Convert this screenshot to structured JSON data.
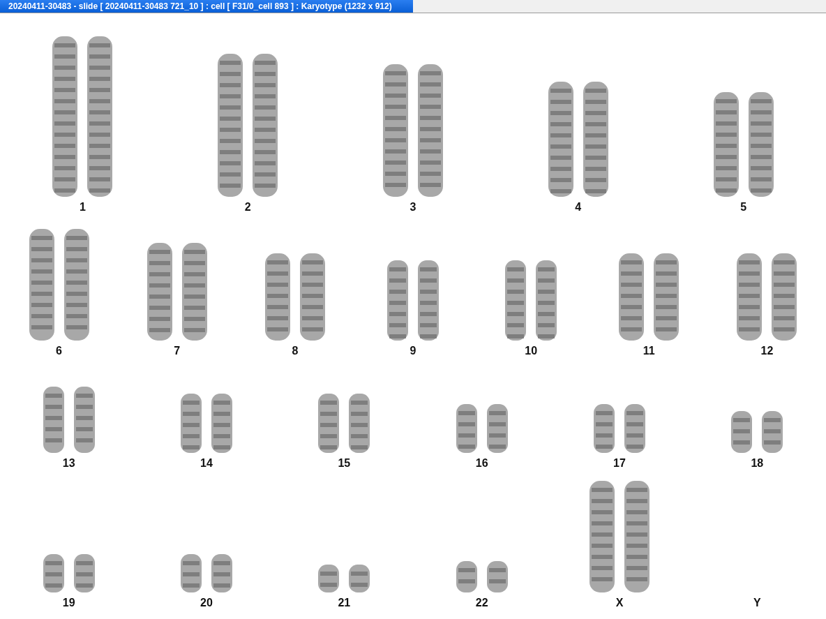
{
  "window": {
    "title": "20240411-30483 - slide [ 20240411-30483 721_10 ] : cell [ F31/0_cell 893 ] : Karyotype  (1232 x 912)"
  },
  "karyotype": {
    "rows": [
      [
        {
          "label": "1"
        },
        {
          "label": "2"
        },
        {
          "label": "3"
        },
        {
          "label": "4"
        },
        {
          "label": "5"
        }
      ],
      [
        {
          "label": "6"
        },
        {
          "label": "7"
        },
        {
          "label": "8"
        },
        {
          "label": "9"
        },
        {
          "label": "10"
        },
        {
          "label": "11"
        },
        {
          "label": "12"
        }
      ],
      [
        {
          "label": "13"
        },
        {
          "label": "14"
        },
        {
          "label": "15"
        },
        {
          "label": "16"
        },
        {
          "label": "17"
        },
        {
          "label": "18"
        }
      ],
      [
        {
          "label": "19"
        },
        {
          "label": "20"
        },
        {
          "label": "21"
        },
        {
          "label": "22"
        },
        {
          "label": "X"
        },
        {
          "label": "Y"
        }
      ]
    ]
  }
}
